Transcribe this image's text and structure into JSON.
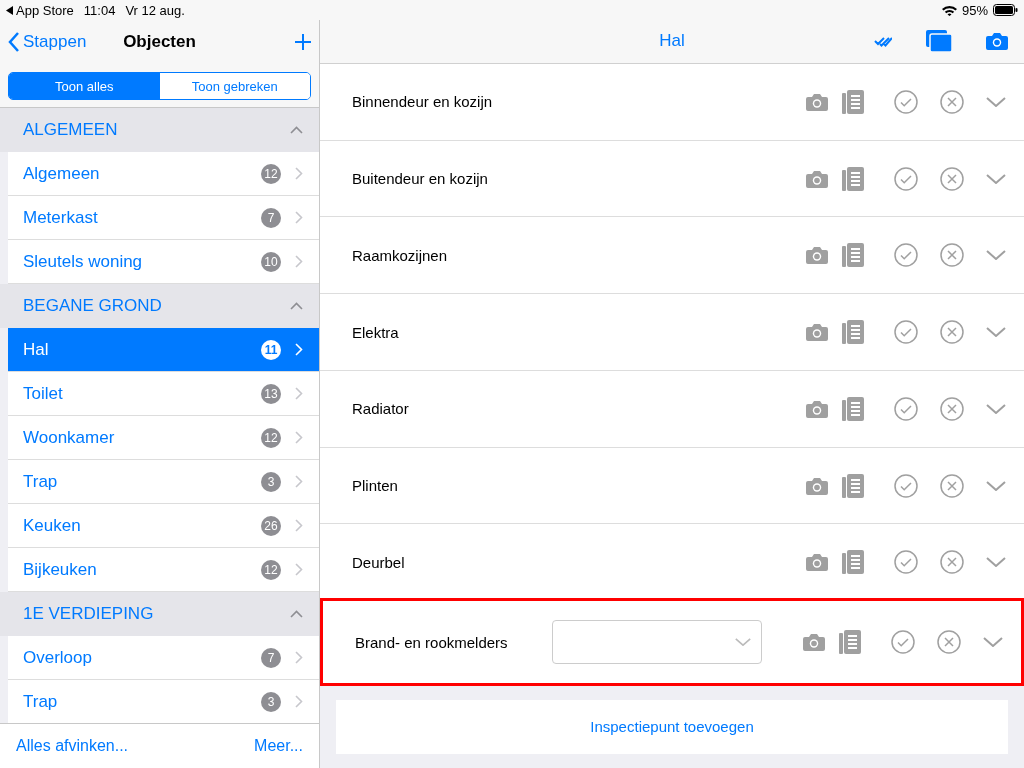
{
  "status_bar": {
    "back_app": "App Store",
    "time": "11:04",
    "date": "Vr 12 aug.",
    "battery": "95%"
  },
  "sidebar": {
    "back": "Stappen",
    "title": "Objecten",
    "segments": [
      {
        "label": "Toon alles",
        "selected": true
      },
      {
        "label": "Toon gebreken",
        "selected": false
      }
    ],
    "sections": [
      {
        "title": "ALGEMEEN",
        "expanded": true,
        "items": [
          {
            "label": "Algemeen",
            "count": "12",
            "selected": false
          },
          {
            "label": "Meterkast",
            "count": "7",
            "selected": false
          },
          {
            "label": "Sleutels woning",
            "count": "10",
            "selected": false
          }
        ]
      },
      {
        "title": "BEGANE GROND",
        "expanded": true,
        "items": [
          {
            "label": "Hal",
            "count": "11",
            "selected": true
          },
          {
            "label": "Toilet",
            "count": "13",
            "selected": false
          },
          {
            "label": "Woonkamer",
            "count": "12",
            "selected": false
          },
          {
            "label": "Trap",
            "count": "3",
            "selected": false
          },
          {
            "label": "Keuken",
            "count": "26",
            "selected": false
          },
          {
            "label": "Bijkeuken",
            "count": "12",
            "selected": false
          }
        ]
      },
      {
        "title": "1E VERDIEPING",
        "expanded": true,
        "items": [
          {
            "label": "Overloop",
            "count": "7",
            "selected": false
          },
          {
            "label": "Trap",
            "count": "3",
            "selected": false
          }
        ]
      }
    ],
    "footer": [
      "Alles afvinken...",
      "Meer..."
    ]
  },
  "main": {
    "title": "Hal",
    "items": [
      {
        "label": "Binnendeur en kozijn",
        "kind": "plain",
        "highlighted": false
      },
      {
        "label": "Buitendeur en kozijn",
        "kind": "plain",
        "highlighted": false
      },
      {
        "label": "Raamkozijnen",
        "kind": "plain",
        "highlighted": false
      },
      {
        "label": "Elektra",
        "kind": "plain",
        "highlighted": false
      },
      {
        "label": "Radiator",
        "kind": "plain",
        "highlighted": false
      },
      {
        "label": "Plinten",
        "kind": "plain",
        "highlighted": false
      },
      {
        "label": "Deurbel",
        "kind": "plain",
        "highlighted": false
      },
      {
        "label": "Brand- en rookmelders",
        "kind": "dropdown",
        "highlighted": true
      }
    ],
    "add_button": "Inspectiepunt toevoegen"
  }
}
